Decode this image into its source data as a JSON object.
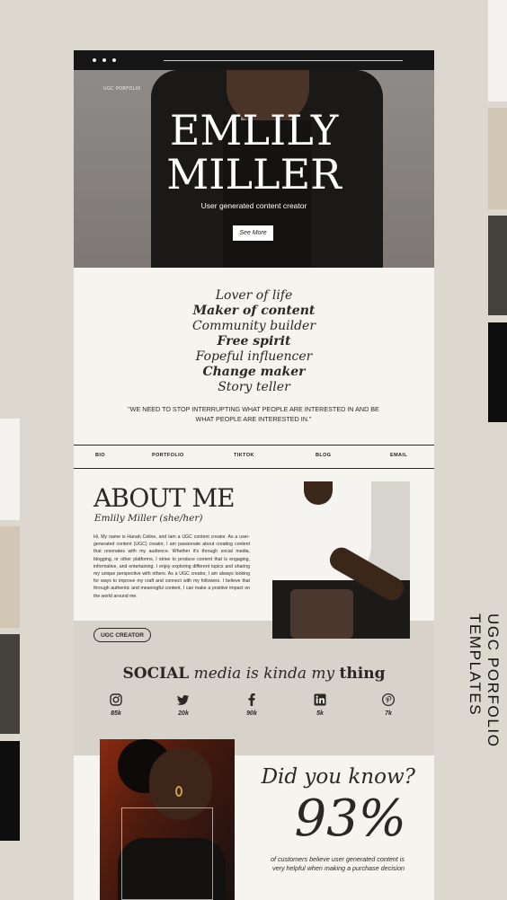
{
  "page": {
    "side_title": "UGC PORFOLIO TEMPLATES"
  },
  "colors": {
    "swatches": [
      "#f4f2ee",
      "#d2c6b4",
      "#45413d",
      "#0e0e0e"
    ]
  },
  "hero": {
    "label": "UGC PORFOLIO",
    "name_line1": "EMLILY",
    "name_line2": "MILLER",
    "subtitle": "User generated content creator",
    "button": "See More"
  },
  "taglines": [
    "Lover of life",
    "Maker of content",
    "Community builder",
    "Free spirit",
    "Fopeful influencer",
    "Change maker",
    "Story teller"
  ],
  "quote": "\"WE NEED TO STOP INTERRUPTING WHAT PEOPLE ARE INTERESTED IN AND BE WHAT PEOPLE ARE INTERESTED IN.\"",
  "nav": {
    "items": [
      "BIO",
      "PORTFOLIO",
      "TIKTOK",
      "BLOG",
      "EMAIL"
    ]
  },
  "about": {
    "title": "ABOUT ME",
    "subtitle": "Emlily Miller (she/her)",
    "text": "Hi, My name is Hanah Celine, and Iam a UGC content creator. As a user-generated content (UGC) creator, I am passionate about creating content that resonates with my audience. Whether it's through social media, blogging, or other platforms, I strive to produce content that is engaging, informative, and entertaining. I enjoy exploring different topics and sharing my unique perspective with others. As a UGC creator, I am always looking for ways to improve my craft and connect with my followers. I believe that through authentic and meaningful content, I can make a positive impact on the world around me.",
    "button": "UGC CREATOR"
  },
  "social": {
    "title_a": "SOCIAL",
    "title_b": "media",
    "title_c": "is",
    "title_d": "kinda",
    "title_e": "my",
    "title_f": "thing",
    "items": [
      {
        "icon": "instagram-icon",
        "count": "85k"
      },
      {
        "icon": "twitter-icon",
        "count": "20k"
      },
      {
        "icon": "facebook-icon",
        "count": "90k"
      },
      {
        "icon": "linkedin-icon",
        "count": "5k"
      },
      {
        "icon": "pinterest-icon",
        "count": "7k"
      }
    ]
  },
  "did_you_know": {
    "title": "Did you know?",
    "stat": "93%",
    "text": "of customers believe user generated content is very helpful when making a purchase decision"
  }
}
